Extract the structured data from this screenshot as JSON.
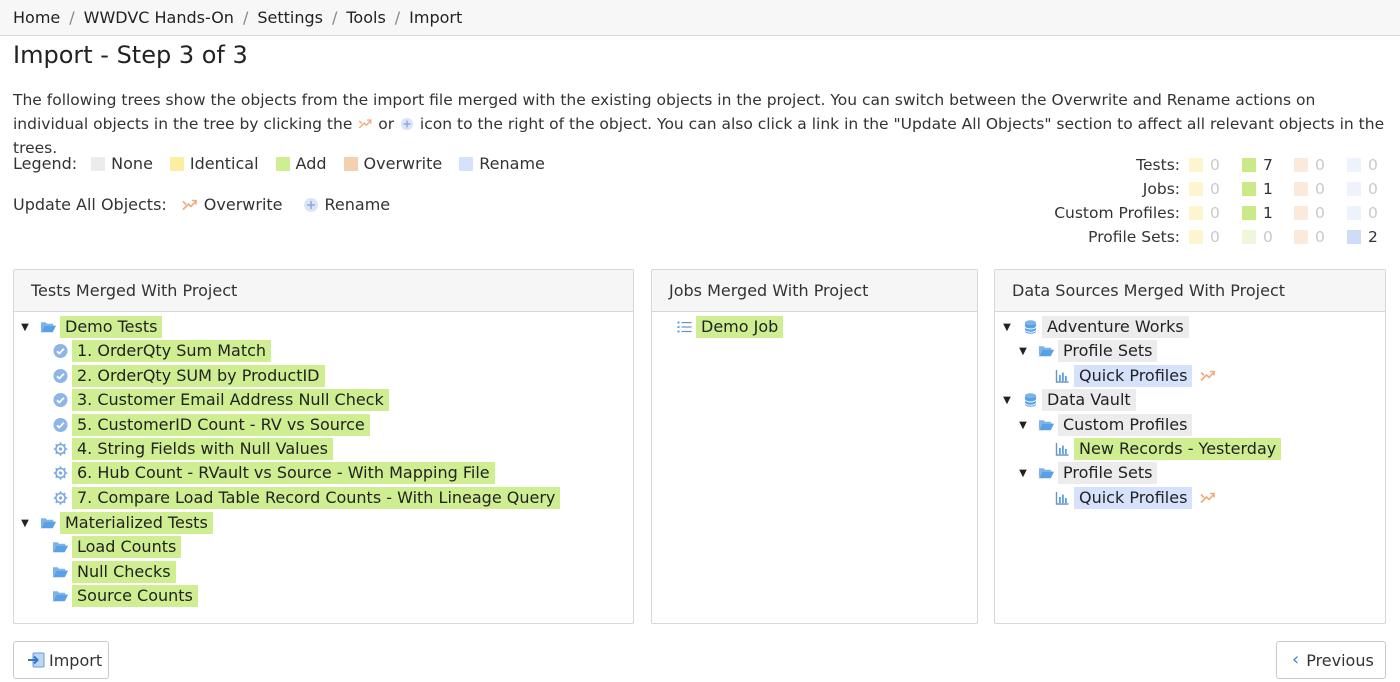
{
  "breadcrumb": [
    "Home",
    "WWDVC Hands-On",
    "Settings",
    "Tools",
    "Import"
  ],
  "title": "Import - Step 3 of 3",
  "description": {
    "part1": "The following trees show the objects from the import file merged with the existing objects in the project. You can switch between the Overwrite and Rename actions on individual objects in the tree by clicking the ",
    "part2": " or ",
    "part3": " icon to the right of the object. You can also click a link in the \"Update All Objects\" section to affect all relevant objects in the trees."
  },
  "legend": {
    "label": "Legend:",
    "items": [
      {
        "label": "None",
        "color": "#ececec"
      },
      {
        "label": "Identical",
        "color": "#fbeea0"
      },
      {
        "label": "Add",
        "color": "#cfee91"
      },
      {
        "label": "Overwrite",
        "color": "#f4cfb0"
      },
      {
        "label": "Rename",
        "color": "#d6e2fb"
      }
    ]
  },
  "update_all": {
    "label": "Update All Objects:",
    "overwrite": "Overwrite",
    "rename": "Rename"
  },
  "summary": [
    {
      "label": "Tests:",
      "values": [
        "0",
        "7",
        "0",
        "0"
      ]
    },
    {
      "label": "Jobs:",
      "values": [
        "0",
        "1",
        "0",
        "0"
      ]
    },
    {
      "label": "Custom Profiles:",
      "values": [
        "0",
        "1",
        "0",
        "0"
      ]
    },
    {
      "label": "Profile Sets:",
      "values": [
        "0",
        "0",
        "0",
        "2"
      ]
    }
  ],
  "panels": {
    "tests": {
      "title": "Tests Merged With Project",
      "root1": "Demo Tests",
      "items": [
        "1. OrderQty Sum Match",
        "2. OrderQty SUM by ProductID",
        "3. Customer Email Address Null Check",
        "5. CustomerID Count - RV vs Source",
        "4. String Fields with Null Values",
        "6. Hub Count - RVault vs Source - With Mapping File",
        "7. Compare Load Table Record Counts - With Lineage Query"
      ],
      "root2": "Materialized Tests",
      "folders": [
        "Load Counts",
        "Null Checks",
        "Source Counts"
      ]
    },
    "jobs": {
      "title": "Jobs Merged With Project",
      "items": [
        "Demo Job"
      ]
    },
    "datasources": {
      "title": "Data Sources Merged With Project",
      "ds1": "Adventure Works",
      "ds1_folder": "Profile Sets",
      "ds1_item": "Quick Profiles",
      "ds2": "Data Vault",
      "ds2_folder1": "Custom Profiles",
      "ds2_item1": "New Records - Yesterday",
      "ds2_folder2": "Profile Sets",
      "ds2_item2": "Quick Profiles"
    }
  },
  "buttons": {
    "import": "Import",
    "previous": "Previous"
  }
}
